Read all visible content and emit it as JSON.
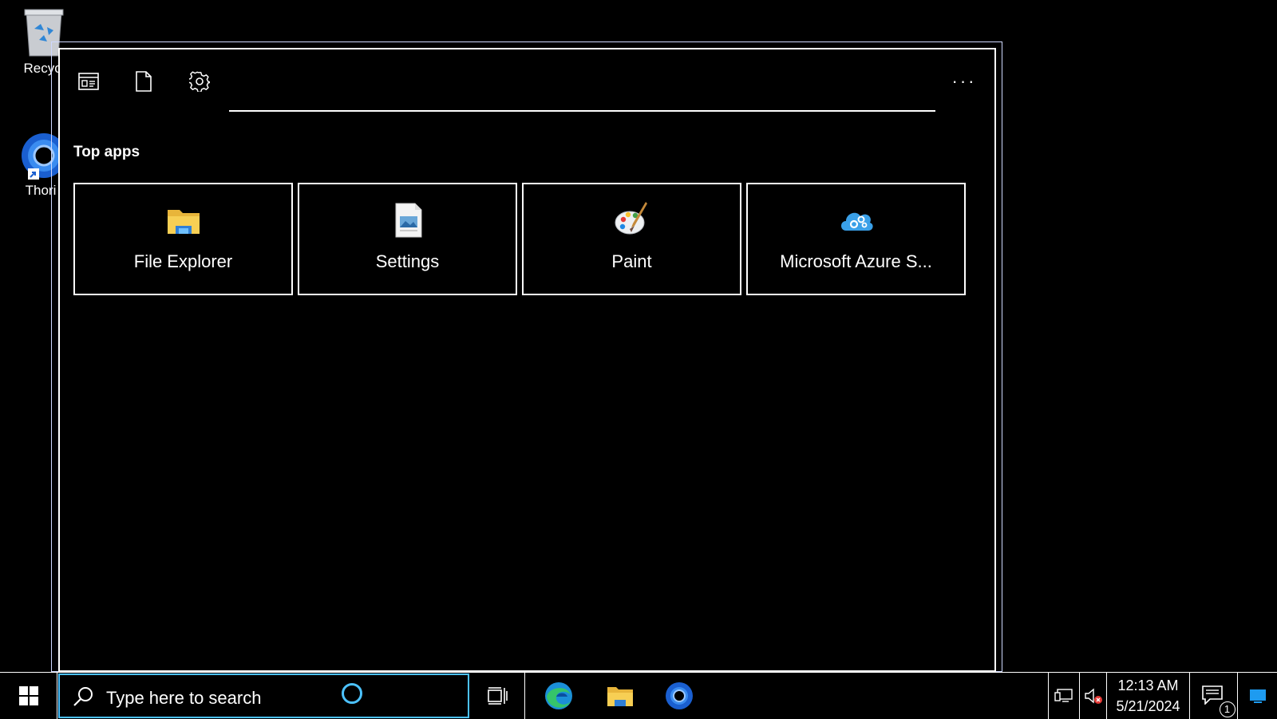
{
  "desktop": {
    "icons": [
      {
        "label": "Recycl",
        "icon": "recycle-bin-icon"
      },
      {
        "label": "Thori",
        "icon": "thorium-browser-icon"
      }
    ]
  },
  "panel": {
    "tabs": [
      {
        "icon": "apps-tab-icon"
      },
      {
        "icon": "documents-tab-icon"
      },
      {
        "icon": "settings-gear-icon"
      }
    ],
    "more_label": "···",
    "section_title": "Top apps",
    "top_apps": [
      {
        "label": "File Explorer",
        "icon": "folder-icon"
      },
      {
        "label": "Settings",
        "icon": "settings-doc-icon"
      },
      {
        "label": "Paint",
        "icon": "paint-palette-icon"
      },
      {
        "label": "Microsoft Azure S...",
        "icon": "azure-cloud-icon"
      }
    ]
  },
  "taskbar": {
    "search_placeholder": "Type here to search",
    "pinned": [
      "edge-icon",
      "file-explorer-icon",
      "thorium-icon"
    ],
    "clock_time": "12:13 AM",
    "clock_date": "5/21/2024",
    "notification_count": "1"
  },
  "colors": {
    "background": "#000000",
    "accent": "#4cc2ff",
    "frame": "#ffffff"
  }
}
